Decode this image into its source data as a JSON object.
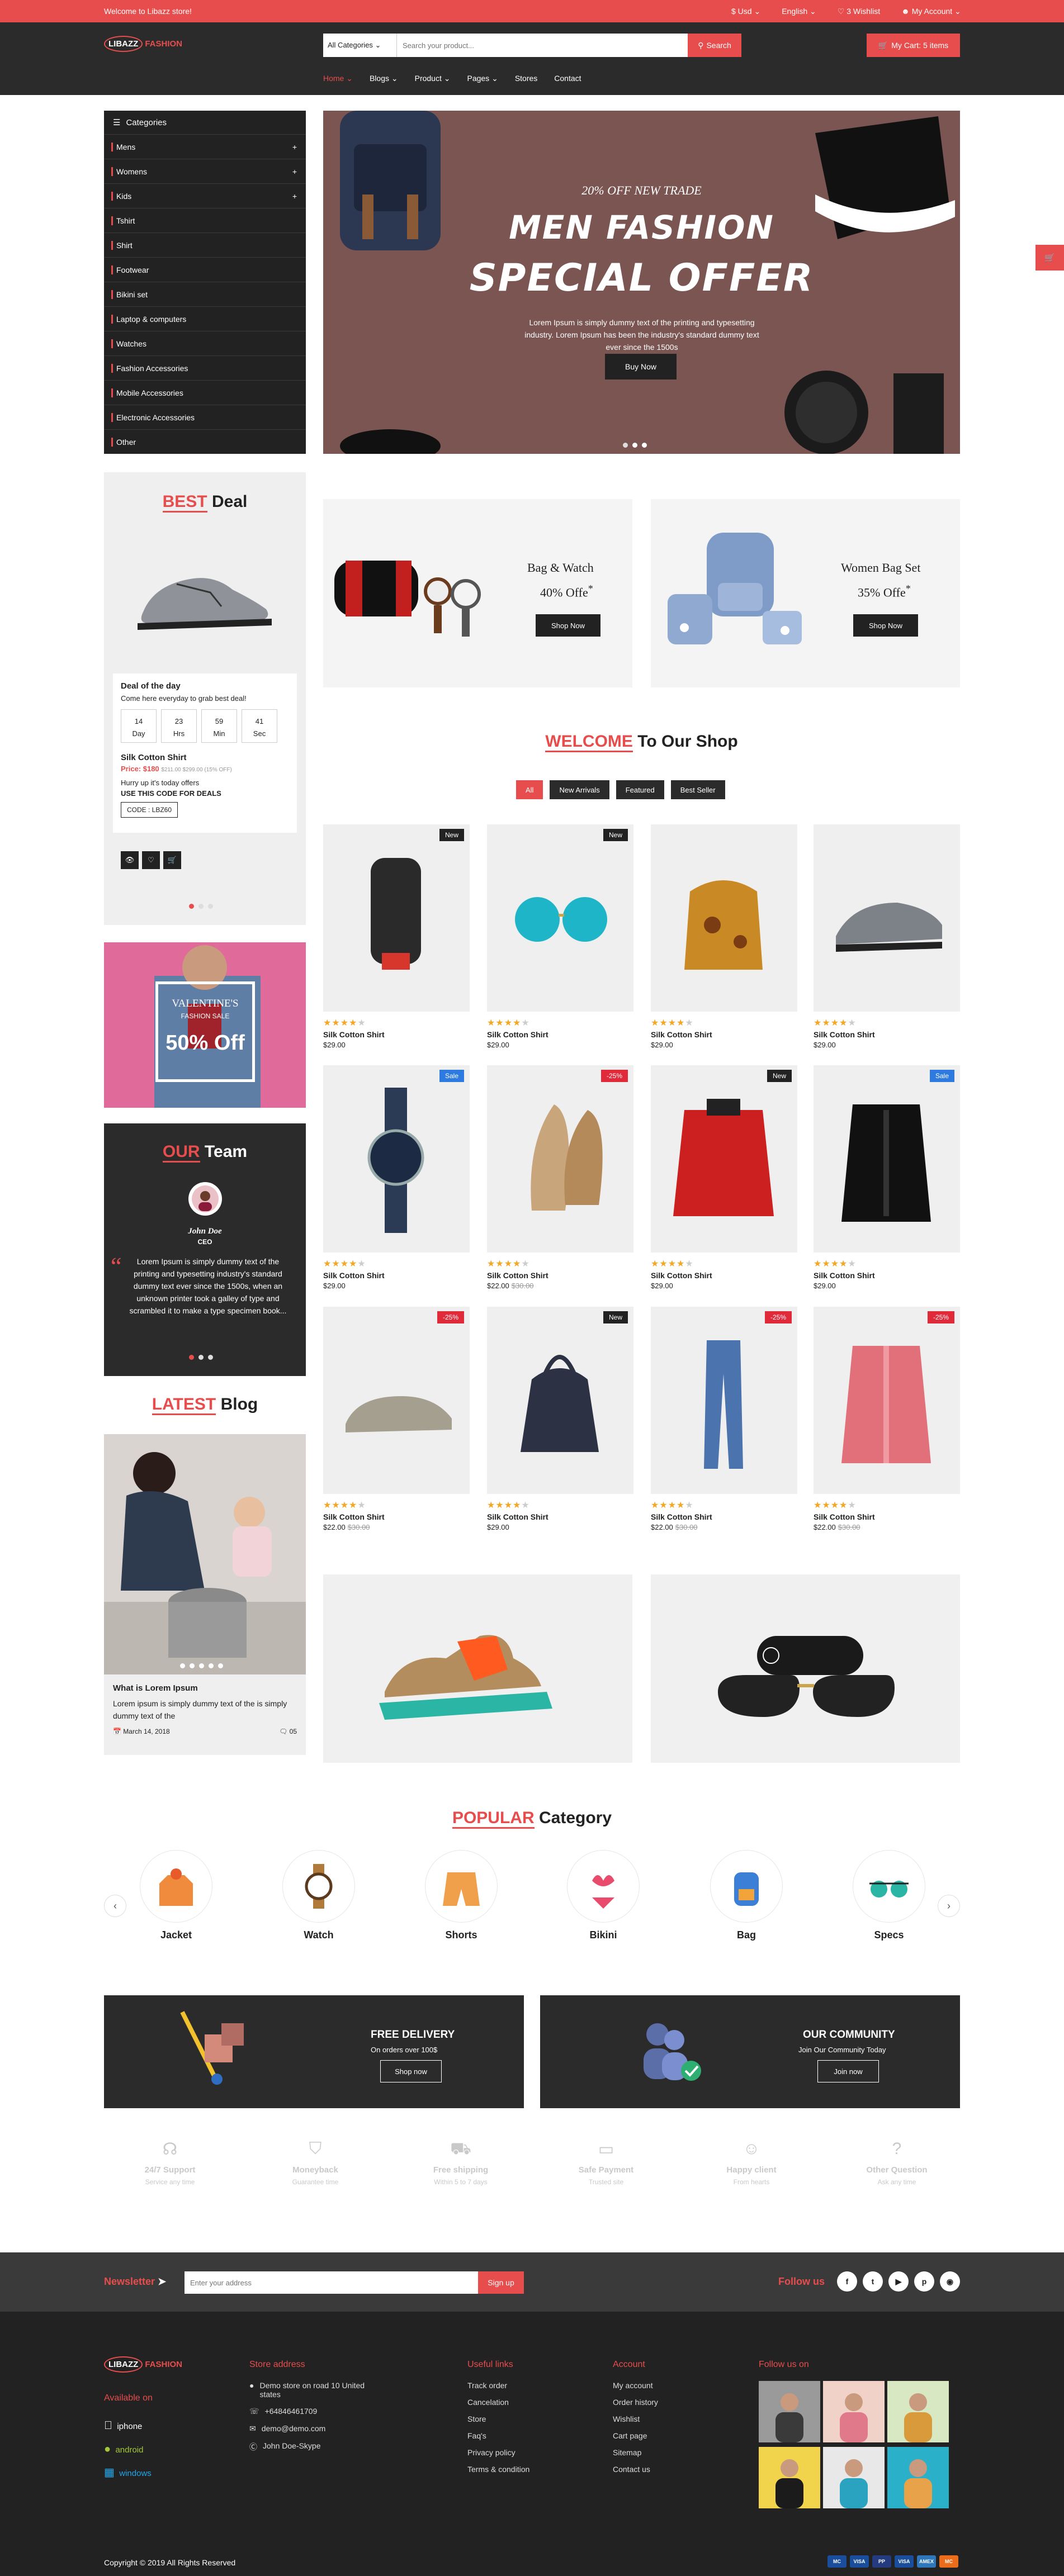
{
  "topbar": {
    "welcome": "Welcome to Libazz store!",
    "currency": "$ Usd ⌄",
    "language": "English ⌄",
    "wishlist": "♡ 3 Wishlist",
    "account": "My Account ⌄"
  },
  "header": {
    "logo_ring": "LIBAZZ",
    "logo_word": "FASHION",
    "search_category": "All Categories ⌄",
    "search_placeholder": "Search your product...",
    "search_button": "Search",
    "cart": "My Cart: 5 items"
  },
  "nav": [
    "Home ⌄",
    "Blogs ⌄",
    "Product ⌄",
    "Pages ⌄",
    "Stores",
    "Contact"
  ],
  "categories": {
    "title": "Categories",
    "items": [
      {
        "label": "Mens",
        "plus": "+"
      },
      {
        "label": "Womens",
        "plus": "+"
      },
      {
        "label": "Kids",
        "plus": "+"
      },
      {
        "label": "Tshirt",
        "plus": ""
      },
      {
        "label": "Shirt",
        "plus": ""
      },
      {
        "label": "Footwear",
        "plus": ""
      },
      {
        "label": "Bikini set",
        "plus": ""
      },
      {
        "label": "Laptop & computers",
        "plus": ""
      },
      {
        "label": "Watches",
        "plus": ""
      },
      {
        "label": "Fashion Accessories",
        "plus": ""
      },
      {
        "label": "Mobile Accessories",
        "plus": ""
      },
      {
        "label": "Electronic Accessories",
        "plus": ""
      },
      {
        "label": "Other",
        "plus": ""
      }
    ]
  },
  "hero": {
    "kicker": "20% OFF NEW TRADE",
    "line1": "MEN FASHION",
    "line2": "SPECIAL OFFER",
    "text": "Lorem Ipsum is simply dummy text of the printing and typesetting industry. Lorem Ipsum has been the industry's standard dummy text ever since the 1500s",
    "button": "Buy Now"
  },
  "deal": {
    "heading_red": "BEST",
    "heading_black": "Deal",
    "box_title": "Deal of the day",
    "box_sub": "Come here everyday to grab best deal!",
    "countdown": [
      {
        "v": "14",
        "u": "Day"
      },
      {
        "v": "23",
        "u": "Hrs"
      },
      {
        "v": "59",
        "u": "Min"
      },
      {
        "v": "41",
        "u": "Sec"
      }
    ],
    "product": "Silk Cotton Shirt",
    "price": "Price: $180",
    "old_price": "$211.00  $299.00 (15% OFF)",
    "hurry": "Hurry up it's today offers",
    "use_code": "USE THIS CODE FOR DEALS",
    "code": "CODE : LBZ60"
  },
  "promo": {
    "line1": "VALENTINE'S",
    "line2": "FASHION SALE",
    "line3": "50% Off"
  },
  "team": {
    "heading_red": "OUR",
    "heading_white": "Team",
    "name": "John Doe",
    "role": "CEO",
    "quote": "Lorem Ipsum is simply dummy text of the printing and typesetting industry's standard dummy text ever since the 1500s, when an unknown printer took a galley of type and scrambled it to make a type specimen book..."
  },
  "blog": {
    "heading_red": "LATEST",
    "heading_black": "Blog",
    "title": "What is Lorem Ipsum",
    "text": "Lorem ipsum is simply dummy text of the is simply dummy text of the",
    "date": "March 14, 2018",
    "comments": "05"
  },
  "banners": [
    {
      "title": "Bag & Watch",
      "off": "40% Offe",
      "button": "Shop Now"
    },
    {
      "title": "Women Bag Set",
      "off": "35% Offe",
      "button": "Shop Now"
    }
  ],
  "shop": {
    "heading_red": "WELCOME",
    "heading_black": "To Our Shop",
    "tabs": [
      "All",
      "New Arrivals",
      "Featured",
      "Best Seller"
    ]
  },
  "products": [
    {
      "name": "Silk Cotton Shirt",
      "price": "$29.00",
      "old": "",
      "badge": "New",
      "rating": 4
    },
    {
      "name": "Silk Cotton Shirt",
      "price": "$29.00",
      "old": "",
      "badge": "New",
      "rating": 4
    },
    {
      "name": "Silk Cotton Shirt",
      "price": "$29.00",
      "old": "",
      "badge": "",
      "rating": 4
    },
    {
      "name": "Silk Cotton Shirt",
      "price": "$29.00",
      "old": "",
      "badge": "",
      "rating": 4
    },
    {
      "name": "Silk Cotton Shirt",
      "price": "$29.00",
      "old": "",
      "badge": "Sale",
      "rating": 4
    },
    {
      "name": "Silk Cotton Shirt",
      "price": "$22.00",
      "old": "$30.00",
      "badge": "-25%",
      "rating": 4
    },
    {
      "name": "Silk Cotton Shirt",
      "price": "$29.00",
      "old": "",
      "badge": "New",
      "rating": 4
    },
    {
      "name": "Silk Cotton Shirt",
      "price": "$29.00",
      "old": "",
      "badge": "Sale",
      "rating": 4
    },
    {
      "name": "Silk Cotton Shirt",
      "price": "$22.00",
      "old": "$30.00",
      "badge": "-25%",
      "rating": 4
    },
    {
      "name": "Silk Cotton Shirt",
      "price": "$29.00",
      "old": "",
      "badge": "New",
      "rating": 4
    },
    {
      "name": "Silk Cotton Shirt",
      "price": "$22.00",
      "old": "$30.00",
      "badge": "-25%",
      "rating": 4
    },
    {
      "name": "Silk Cotton Shirt",
      "price": "$22.00",
      "old": "$30.00",
      "badge": "-25%",
      "rating": 4
    }
  ],
  "popular": {
    "heading_red": "POPULAR",
    "heading_black": "Category",
    "items": [
      "Jacket",
      "Watch",
      "Shorts",
      "Bikini",
      "Bag",
      "Specs"
    ]
  },
  "features": [
    {
      "title": "FREE DELIVERY",
      "sub": "On orders over 100$",
      "button": "Shop now"
    },
    {
      "title": "OUR COMMUNITY",
      "sub": "Join Our Community Today",
      "button": "Join now"
    }
  ],
  "services": [
    {
      "icon": "☊",
      "title": "24/7 Support",
      "sub": "Service any time"
    },
    {
      "icon": "⛉",
      "title": "Moneyback",
      "sub": "Guarantee time"
    },
    {
      "icon": "⛟",
      "title": "Free shipping",
      "sub": "Within 5 to 7 days"
    },
    {
      "icon": "▭",
      "title": "Safe Payment",
      "sub": "Trusted site"
    },
    {
      "icon": "☺",
      "title": "Happy client",
      "sub": "From hearts"
    },
    {
      "icon": "?",
      "title": "Other Question",
      "sub": "Ask any time"
    }
  ],
  "newsletter": {
    "label": "Newsletter",
    "placeholder": "Enter your address",
    "button": "Sign up",
    "follow": "Follow us"
  },
  "footer": {
    "available": "Available on",
    "apps": [
      "iphone",
      "android",
      "windows"
    ],
    "store": {
      "title": "Store address",
      "lines": [
        "Demo store on road 10 United states",
        "+64846461709",
        "demo@demo.com",
        "John Doe-Skype"
      ]
    },
    "useful": {
      "title": "Useful links",
      "items": [
        "Track order",
        "Cancelation",
        "Store",
        "Faq's",
        "Privacy policy",
        "Terms & condition"
      ]
    },
    "account": {
      "title": "Account",
      "items": [
        "My account",
        "Order history",
        "Wishlist",
        "Cart page",
        "Sitemap",
        "Contact us"
      ]
    },
    "follow": "Follow us on",
    "copyright": "Copyright © 2019 All Rights Reserved",
    "payments": [
      "MC",
      "VISA",
      "PP",
      "VISA",
      "AMEX",
      "MC"
    ]
  },
  "colors": {
    "accent": "#e84d4d",
    "dark": "#2b2b2b"
  }
}
